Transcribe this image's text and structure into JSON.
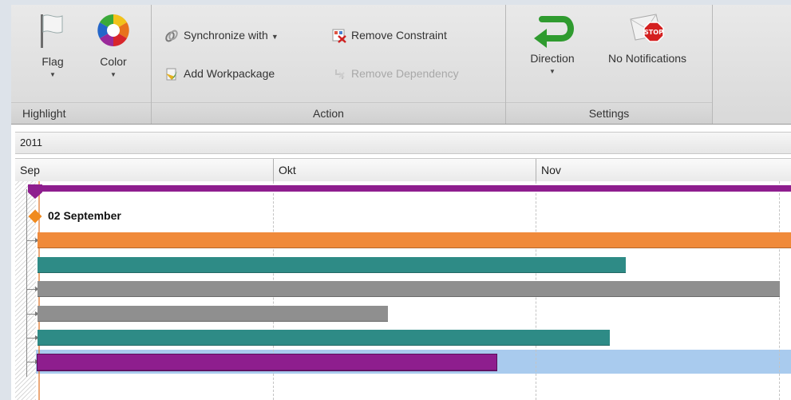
{
  "ribbon": {
    "groups": {
      "highlight": {
        "label": "Highlight",
        "flag_label": "Flag",
        "color_label": "Color"
      },
      "action": {
        "label": "Action",
        "synchronize_label": "Synchronize with",
        "add_workpackage_label": "Add Workpackage",
        "remove_constraint_label": "Remove Constraint",
        "remove_dependency_label": "Remove Dependency"
      },
      "settings": {
        "label": "Settings",
        "direction_label": "Direction",
        "notifications_label": "No Notifications"
      }
    }
  },
  "timeline": {
    "year": "2011",
    "months": [
      "Sep",
      "Okt",
      "Nov"
    ],
    "milestone_label": "02 September",
    "colors": {
      "summary": "#8e1e8e",
      "orange": "#f08a3a",
      "teal": "#2e8b86",
      "gray": "#8f8f8f",
      "purple": "#8e1e8e",
      "selection": "#a9cbee"
    }
  }
}
